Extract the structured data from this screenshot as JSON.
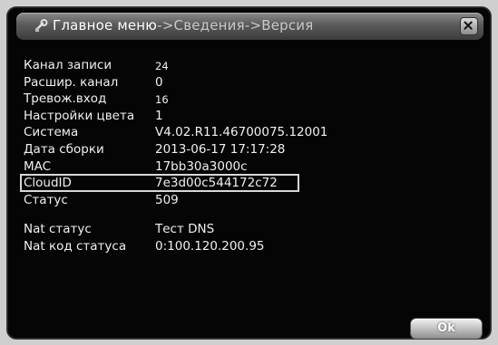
{
  "window": {
    "title_current": "Главное меню",
    "title_rest": "->Сведения->Версия"
  },
  "rows": [
    {
      "label": "Канал записи",
      "value": "24"
    },
    {
      "label": "Расшир. канал",
      "value": "0"
    },
    {
      "label": "Тревож.вход",
      "value": "16"
    },
    {
      "label": "Настройки цвета",
      "value": "1"
    },
    {
      "label": "Система",
      "value": "V4.02.R11.46700075.12001"
    },
    {
      "label": "Дата сборки",
      "value": "2013-06-17 17:17:28"
    },
    {
      "label": "MAC",
      "value": "17bb30a3000c"
    },
    {
      "label": "CloudID",
      "value": "7e3d00c544172c72"
    },
    {
      "label": "Статус",
      "value": "509"
    }
  ],
  "nat": [
    {
      "label": "Nat статус",
      "value": "Тест DNS"
    },
    {
      "label": "Nat код статуса",
      "value": "0:100.120.200.95"
    }
  ],
  "buttons": {
    "ok_label": "Ok"
  },
  "icons": {
    "title": "settings-icon",
    "close": "close-icon"
  }
}
